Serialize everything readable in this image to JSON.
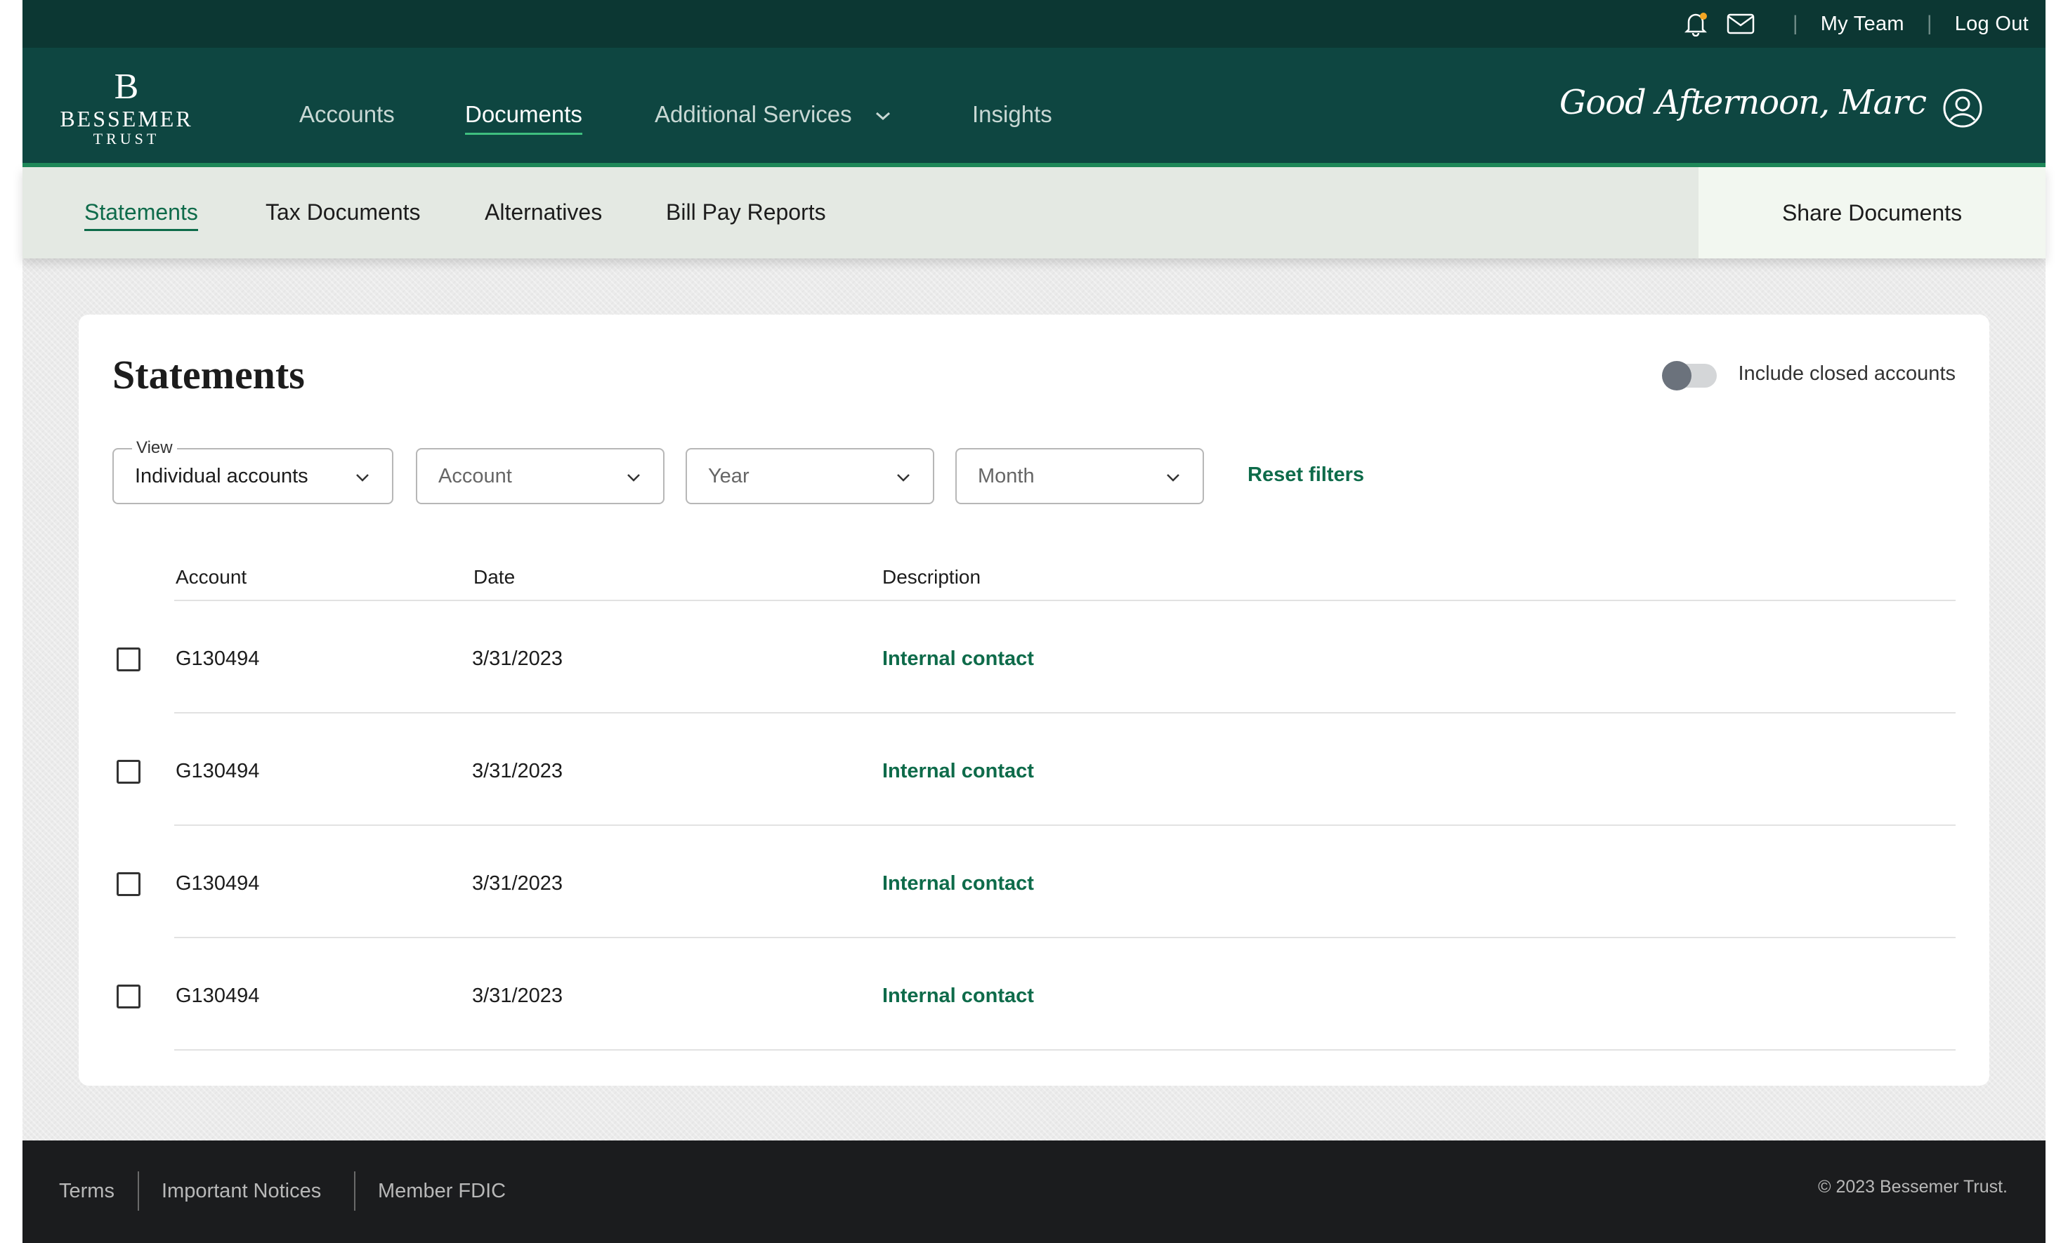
{
  "utility": {
    "my_team": "My Team",
    "log_out": "Log Out",
    "separator": "|"
  },
  "brand": {
    "mark": "B",
    "name": "BESSEMER",
    "sub": "TRUST"
  },
  "nav": {
    "items": [
      {
        "label": "Accounts"
      },
      {
        "label": "Documents"
      },
      {
        "label": "Additional Services"
      },
      {
        "label": "Insights"
      }
    ],
    "greeting": "Good Afternoon, Marc"
  },
  "subnav": {
    "items": [
      {
        "label": "Statements"
      },
      {
        "label": "Tax Documents"
      },
      {
        "label": "Alternatives"
      },
      {
        "label": "Bill Pay Reports"
      }
    ],
    "share": "Share Documents"
  },
  "statements": {
    "title": "Statements",
    "toggle_label": "Include closed accounts",
    "filters": {
      "view_legend": "View",
      "view_value": "Individual accounts",
      "account_placeholder": "Account",
      "year_placeholder": "Year",
      "month_placeholder": "Month",
      "reset": "Reset filters"
    },
    "columns": [
      "Account",
      "Date",
      "Description"
    ],
    "rows": [
      {
        "account": "G130494",
        "date": "3/31/2023",
        "description": "Internal contact"
      },
      {
        "account": "G130494",
        "date": "3/31/2023",
        "description": "Internal contact"
      },
      {
        "account": "G130494",
        "date": "3/31/2023",
        "description": "Internal contact"
      },
      {
        "account": "G130494",
        "date": "3/31/2023",
        "description": "Internal contact"
      }
    ]
  },
  "footer": {
    "links": [
      {
        "label": "Terms"
      },
      {
        "label": "Important Notices"
      },
      {
        "label": "Member FDIC"
      }
    ],
    "copyright": "© 2023 Bessemer Trust."
  },
  "colors": {
    "utility_bg": "#0c3733",
    "nav_bg": "#0e4641",
    "accent_green": "#0e6b4a",
    "subnav_bg": "#e4e9e3",
    "footer_bg": "#1b1c1e",
    "notification_dot": "#f5a623"
  },
  "icons": [
    "bell-icon",
    "mail-icon",
    "chevron-down-icon",
    "user-circle-icon"
  ]
}
